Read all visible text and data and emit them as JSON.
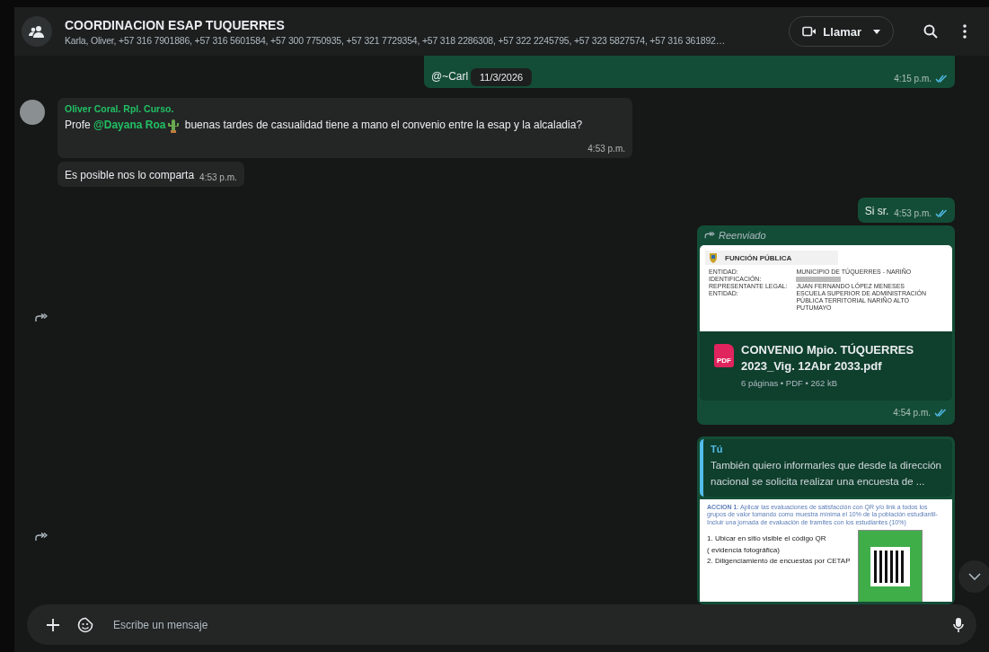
{
  "header": {
    "title": "COORDINACION ESAP TUQUERRES",
    "members": "Karla, Oliver, +57 316 7901886, +57 316 5601584, +57 300 7750935, +57 321 7729354, +57 318 2286308, +57 322 2245795, +57 323 5827574, +57 316 361892…",
    "call_label": "Llamar"
  },
  "date_chip": "11/3/2026",
  "messages": [
    {
      "kind": "text",
      "outgoing": true,
      "parts": [
        {
          "kind": "text",
          "text": "@~Carl"
        }
      ],
      "time": "4:15 p.m.",
      "read": true
    },
    {
      "kind": "text",
      "outgoing": false,
      "sender": "Oliver Coral. Rpl. Curso.",
      "parts": [
        {
          "kind": "text",
          "text": "Profe "
        },
        {
          "kind": "mention",
          "text": "@Dayana Roa"
        },
        {
          "kind": "emoji"
        },
        {
          "kind": "text",
          "text": " buenas tardes de casualidad tiene a mano el convenio entre la esap y la alcaladia?"
        }
      ],
      "time": "4:53 p.m."
    },
    {
      "kind": "text",
      "outgoing": false,
      "parts": [
        {
          "kind": "text",
          "text": "Es posible nos lo comparta"
        }
      ],
      "time": "4:53 p.m."
    },
    {
      "kind": "text",
      "outgoing": true,
      "parts": [
        {
          "kind": "text",
          "text": "Si sr."
        }
      ],
      "time": "4:53 p.m.",
      "read": true
    },
    {
      "kind": "document",
      "outgoing": true,
      "forwarded": "Reenviado",
      "share": true,
      "preview": {
        "brand": "FUNCIÓN PÚBLICA",
        "labels": [
          "ENTIDAD:",
          "IDENTIFICACIÓN:",
          "REPRESENTANTE LEGAL:",
          "ENTIDAD:"
        ],
        "values": [
          "MUNICIPIO DE TÚQUERRES - NARIÑO",
          "JUAN FERNANDO LÓPEZ MENESES",
          "ESCUELA SUPERIOR DE ADMINISTRACIÓN PÚBLICA TERRITORIAL NARIÑO ALTO PUTUMAYO"
        ]
      },
      "file_type": "PDF",
      "file_name": "CONVENIO Mpio. TÚQUERRES 2023_Vig. 12Abr 2033.pdf",
      "file_meta": "6 páginas • PDF • 262 kB",
      "time": "4:54 p.m.",
      "read": true
    },
    {
      "kind": "image",
      "outgoing": true,
      "share": true,
      "quote": {
        "author": "Tú",
        "text": "También quiero informarles que desde la dirección nacional se solicita realizar una encuesta de ..."
      },
      "slide": {
        "heading": "**ACCION 1**: Aplicar las evaluaciones de satisfacción con QR y/o link a todos los grupos de valor tomando como muestra mínima el 10% de la población estudiantil- Incluir una jornada de evaluación de tramites con los estudiantes (10%)",
        "items": [
          "1.   Ubicar en sitio visible el código QR",
          "( evidencia fotográfica)",
          "2. Diligenciamiento de encuestas por CETAP"
        ]
      }
    }
  ],
  "composer": {
    "placeholder": "Escribe un mensaje"
  }
}
